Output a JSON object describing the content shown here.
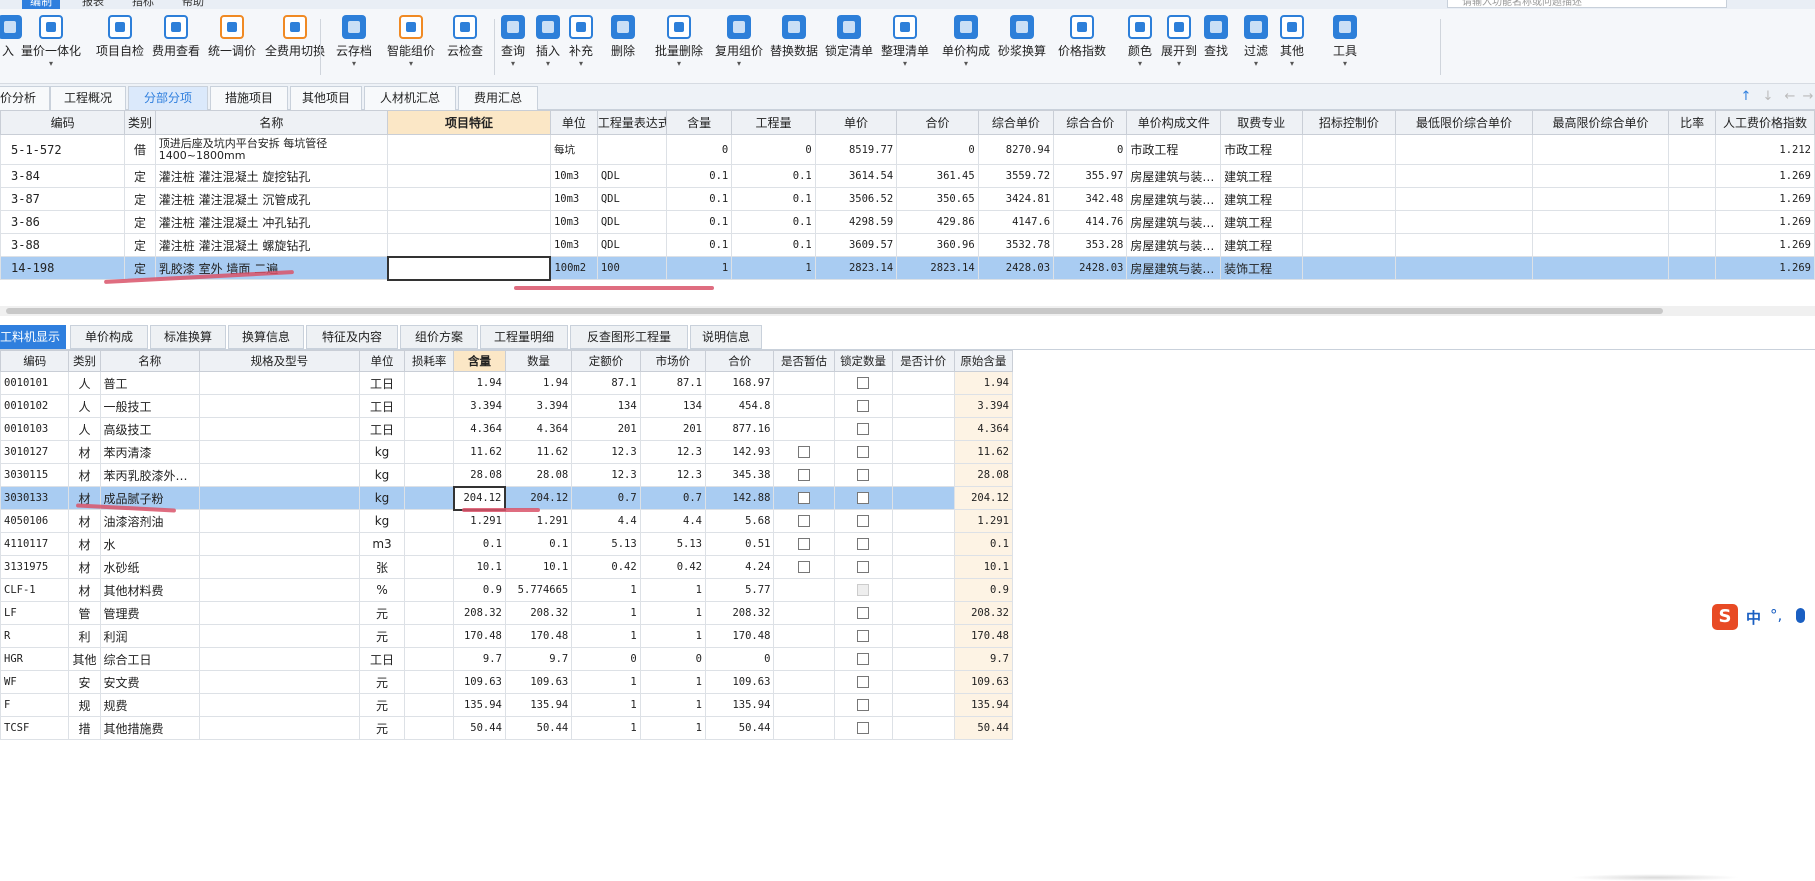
{
  "menubar": {
    "tabs": [
      "编制",
      "报表",
      "指标",
      "帮助"
    ],
    "active": 0,
    "search_placeholder": "请输入功能名称或问题描述"
  },
  "toolbar": {
    "buttons": [
      {
        "label": "入",
        "icon": "import-icon"
      },
      {
        "label": "量价一体化",
        "icon": "quantity-price-icon"
      },
      {
        "label": "项目自检",
        "icon": "project-check-icon"
      },
      {
        "label": "费用查看",
        "icon": "fee-view-icon"
      },
      {
        "label": "统一调价",
        "icon": "uniform-price-icon"
      },
      {
        "label": "全费用切换",
        "icon": "full-fee-switch-icon"
      },
      {
        "label": "云存档",
        "icon": "cloud-save-icon"
      },
      {
        "label": "智能组价",
        "icon": "smart-pricing-icon"
      },
      {
        "label": "云检查",
        "icon": "cloud-check-icon"
      },
      {
        "label": "查询",
        "icon": "query-icon"
      },
      {
        "label": "插入",
        "icon": "insert-icon"
      },
      {
        "label": "补充",
        "icon": "supplement-icon"
      },
      {
        "label": "删除",
        "icon": "delete-icon"
      },
      {
        "label": "批量删除",
        "icon": "batch-delete-icon"
      },
      {
        "label": "复用组价",
        "icon": "reuse-pricing-icon"
      },
      {
        "label": "替换数据",
        "icon": "replace-data-icon"
      },
      {
        "label": "锁定清单",
        "icon": "lock-list-icon"
      },
      {
        "label": "整理清单",
        "icon": "organize-list-icon"
      },
      {
        "label": "单价构成",
        "icon": "unit-price-composition-icon"
      },
      {
        "label": "砂浆换算",
        "icon": "mortar-conversion-icon"
      },
      {
        "label": "价格指数",
        "icon": "price-index-icon"
      },
      {
        "label": "颜色",
        "icon": "color-icon"
      },
      {
        "label": "展开到",
        "icon": "expand-to-icon"
      },
      {
        "label": "查找",
        "icon": "find-icon"
      },
      {
        "label": "过滤",
        "icon": "filter-icon"
      },
      {
        "label": "其他",
        "icon": "other-icon"
      },
      {
        "label": "工具",
        "icon": "tools-icon"
      }
    ]
  },
  "tabs_top": [
    "价分析",
    "工程概况",
    "分部分项",
    "措施项目",
    "其他项目",
    "人材机汇总",
    "费用汇总"
  ],
  "tabs_top_active": 2,
  "upper_grid": {
    "headers": [
      "编码",
      "类别",
      "名称",
      "项目特征",
      "单位",
      "工程量表达式",
      "含量",
      "工程量",
      "单价",
      "合价",
      "综合单价",
      "综合合价",
      "单价构成文件",
      "取费专业",
      "招标控制价",
      "最低限价综合单价",
      "最高限价综合单价",
      "比率",
      "人工费价格指数"
    ],
    "rows": [
      {
        "code": "5-1-572",
        "type": "借",
        "name": "顶进后座及坑内平台安拆 每坑管径1400~1800mm",
        "feature": "",
        "unit": "每坑",
        "expr": "",
        "content": "0",
        "qty": "0",
        "price": "8519.77",
        "total": "0",
        "comp_price": "8270.94",
        "comp_total": "0",
        "file": "市政工程",
        "prof": "市政工程",
        "ctrl": "",
        "minp": "",
        "maxp": "",
        "ratio": "",
        "idx": "1.212"
      },
      {
        "code": "3-84",
        "type": "定",
        "name": "灌注桩 灌注混凝土 旋挖钻孔",
        "feature": "",
        "unit": "10m3",
        "expr": "QDL",
        "content": "0.1",
        "qty": "0.1",
        "price": "3614.54",
        "total": "361.45",
        "comp_price": "3559.72",
        "comp_total": "355.97",
        "file": "房屋建筑与装…",
        "prof": "建筑工程",
        "ctrl": "",
        "minp": "",
        "maxp": "",
        "ratio": "",
        "idx": "1.269"
      },
      {
        "code": "3-87",
        "type": "定",
        "name": "灌注桩 灌注混凝土 沉管成孔",
        "feature": "",
        "unit": "10m3",
        "expr": "QDL",
        "content": "0.1",
        "qty": "0.1",
        "price": "3506.52",
        "total": "350.65",
        "comp_price": "3424.81",
        "comp_total": "342.48",
        "file": "房屋建筑与装…",
        "prof": "建筑工程",
        "ctrl": "",
        "minp": "",
        "maxp": "",
        "ratio": "",
        "idx": "1.269"
      },
      {
        "code": "3-86",
        "type": "定",
        "name": "灌注桩 灌注混凝土 冲孔钻孔",
        "feature": "",
        "unit": "10m3",
        "expr": "QDL",
        "content": "0.1",
        "qty": "0.1",
        "price": "4298.59",
        "total": "429.86",
        "comp_price": "4147.6",
        "comp_total": "414.76",
        "file": "房屋建筑与装…",
        "prof": "建筑工程",
        "ctrl": "",
        "minp": "",
        "maxp": "",
        "ratio": "",
        "idx": "1.269"
      },
      {
        "code": "3-88",
        "type": "定",
        "name": "灌注桩 灌注混凝土 螺旋钻孔",
        "feature": "",
        "unit": "10m3",
        "expr": "QDL",
        "content": "0.1",
        "qty": "0.1",
        "price": "3609.57",
        "total": "360.96",
        "comp_price": "3532.78",
        "comp_total": "353.28",
        "file": "房屋建筑与装…",
        "prof": "建筑工程",
        "ctrl": "",
        "minp": "",
        "maxp": "",
        "ratio": "",
        "idx": "1.269"
      },
      {
        "code": "14-198",
        "type": "定",
        "name": "乳胶漆 室外 墙面 二遍",
        "feature": "",
        "unit": "100m2",
        "expr": "100",
        "content": "1",
        "qty": "1",
        "price": "2823.14",
        "total": "2823.14",
        "comp_price": "2428.03",
        "comp_total": "2428.03",
        "file": "房屋建筑与装…",
        "prof": "装饰工程",
        "ctrl": "",
        "minp": "",
        "maxp": "",
        "ratio": "",
        "idx": "1.269",
        "selected": true
      }
    ]
  },
  "tabs_bottom": [
    "工料机显示",
    "单价构成",
    "标准换算",
    "换算信息",
    "特征及内容",
    "组价方案",
    "工程量明细",
    "反查图形工程量",
    "说明信息"
  ],
  "tabs_bottom_active": 0,
  "lower_grid": {
    "headers": [
      "编码",
      "类别",
      "名称",
      "规格及型号",
      "单位",
      "损耗率",
      "含量",
      "数量",
      "定额价",
      "市场价",
      "合价",
      "是否暂估",
      "锁定数量",
      "是否计价",
      "原始含量"
    ],
    "rows": [
      {
        "code": "0010101",
        "type": "人",
        "name": "普工",
        "spec": "",
        "unit": "工日",
        "loss": "",
        "content": "1.94",
        "qty": "1.94",
        "quota": "87.1",
        "market": "87.1",
        "total": "168.97",
        "est": null,
        "lock": "box",
        "priced": "",
        "orig": "1.94"
      },
      {
        "code": "0010102",
        "type": "人",
        "name": "一般技工",
        "spec": "",
        "unit": "工日",
        "loss": "",
        "content": "3.394",
        "qty": "3.394",
        "quota": "134",
        "market": "134",
        "total": "454.8",
        "est": null,
        "lock": "box",
        "priced": "",
        "orig": "3.394"
      },
      {
        "code": "0010103",
        "type": "人",
        "name": "高级技工",
        "spec": "",
        "unit": "工日",
        "loss": "",
        "content": "4.364",
        "qty": "4.364",
        "quota": "201",
        "market": "201",
        "total": "877.16",
        "est": null,
        "lock": "box",
        "priced": "",
        "orig": "4.364"
      },
      {
        "code": "3010127",
        "type": "材",
        "name": "苯丙清漆",
        "spec": "",
        "unit": "kg",
        "loss": "",
        "content": "11.62",
        "qty": "11.62",
        "quota": "12.3",
        "market": "12.3",
        "total": "142.93",
        "est": "box",
        "lock": "box",
        "priced": "",
        "orig": "11.62"
      },
      {
        "code": "3030115",
        "type": "材",
        "name": "苯丙乳胶漆外墙用",
        "spec": "",
        "unit": "kg",
        "loss": "",
        "content": "28.08",
        "qty": "28.08",
        "quota": "12.3",
        "market": "12.3",
        "total": "345.38",
        "est": "box",
        "lock": "box",
        "priced": "",
        "orig": "28.08"
      },
      {
        "code": "3030133",
        "type": "材",
        "name": "成品腻子粉",
        "spec": "",
        "unit": "kg",
        "loss": "",
        "content": "204.12",
        "qty": "204.12",
        "quota": "0.7",
        "market": "0.7",
        "total": "142.88",
        "est": "box",
        "lock": "box",
        "priced": "",
        "orig": "204.12",
        "selected": true
      },
      {
        "code": "4050106",
        "type": "材",
        "name": "油漆溶剂油",
        "spec": "",
        "unit": "kg",
        "loss": "",
        "content": "1.291",
        "qty": "1.291",
        "quota": "4.4",
        "market": "4.4",
        "total": "5.68",
        "est": "box",
        "lock": "box",
        "priced": "",
        "orig": "1.291"
      },
      {
        "code": "4110117",
        "type": "材",
        "name": "水",
        "spec": "",
        "unit": "m3",
        "loss": "",
        "content": "0.1",
        "qty": "0.1",
        "quota": "5.13",
        "market": "5.13",
        "total": "0.51",
        "est": "box",
        "lock": "box",
        "priced": "",
        "orig": "0.1"
      },
      {
        "code": "3131975",
        "type": "材",
        "name": "水砂纸",
        "spec": "",
        "unit": "张",
        "loss": "",
        "content": "10.1",
        "qty": "10.1",
        "quota": "0.42",
        "market": "0.42",
        "total": "4.24",
        "est": "box",
        "lock": "box",
        "priced": "",
        "orig": "10.1"
      },
      {
        "code": "CLF-1",
        "type": "材",
        "name": "其他材料费",
        "spec": "",
        "unit": "%",
        "loss": "",
        "content": "0.9",
        "qty": "5.774665",
        "quota": "1",
        "market": "1",
        "total": "5.77",
        "est": null,
        "lock": "dis",
        "priced": "",
        "orig": "0.9"
      },
      {
        "code": "LF",
        "type": "管",
        "name": "管理费",
        "spec": "",
        "unit": "元",
        "loss": "",
        "content": "208.32",
        "qty": "208.32",
        "quota": "1",
        "market": "1",
        "total": "208.32",
        "est": null,
        "lock": "box",
        "priced": "",
        "orig": "208.32"
      },
      {
        "code": "R",
        "type": "利",
        "name": "利润",
        "spec": "",
        "unit": "元",
        "loss": "",
        "content": "170.48",
        "qty": "170.48",
        "quota": "1",
        "market": "1",
        "total": "170.48",
        "est": null,
        "lock": "box",
        "priced": "",
        "orig": "170.48"
      },
      {
        "code": "HGR",
        "type": "其他",
        "name": "综合工日",
        "spec": "",
        "unit": "工日",
        "loss": "",
        "content": "9.7",
        "qty": "9.7",
        "quota": "0",
        "market": "0",
        "total": "0",
        "est": null,
        "lock": "box",
        "priced": "",
        "orig": "9.7"
      },
      {
        "code": "WF",
        "type": "安",
        "name": "安文费",
        "spec": "",
        "unit": "元",
        "loss": "",
        "content": "109.63",
        "qty": "109.63",
        "quota": "1",
        "market": "1",
        "total": "109.63",
        "est": null,
        "lock": "box",
        "priced": "",
        "orig": "109.63"
      },
      {
        "code": "F",
        "type": "规",
        "name": "规费",
        "spec": "",
        "unit": "元",
        "loss": "",
        "content": "135.94",
        "qty": "135.94",
        "quota": "1",
        "market": "1",
        "total": "135.94",
        "est": null,
        "lock": "box",
        "priced": "",
        "orig": "135.94"
      },
      {
        "code": "TCSF",
        "type": "措",
        "name": "其他措施费",
        "spec": "",
        "unit": "元",
        "loss": "",
        "content": "50.44",
        "qty": "50.44",
        "quota": "1",
        "market": "1",
        "total": "50.44",
        "est": null,
        "lock": "box",
        "priced": "",
        "orig": "50.44"
      }
    ]
  },
  "ime": {
    "logo": "S",
    "mode": "中",
    "punct": "°,"
  },
  "colors": {
    "accent": "#2f7fde",
    "selected_row": "#a9ccf2",
    "highlight_header": "#fbe7c6",
    "annotation": "#d9546a"
  }
}
